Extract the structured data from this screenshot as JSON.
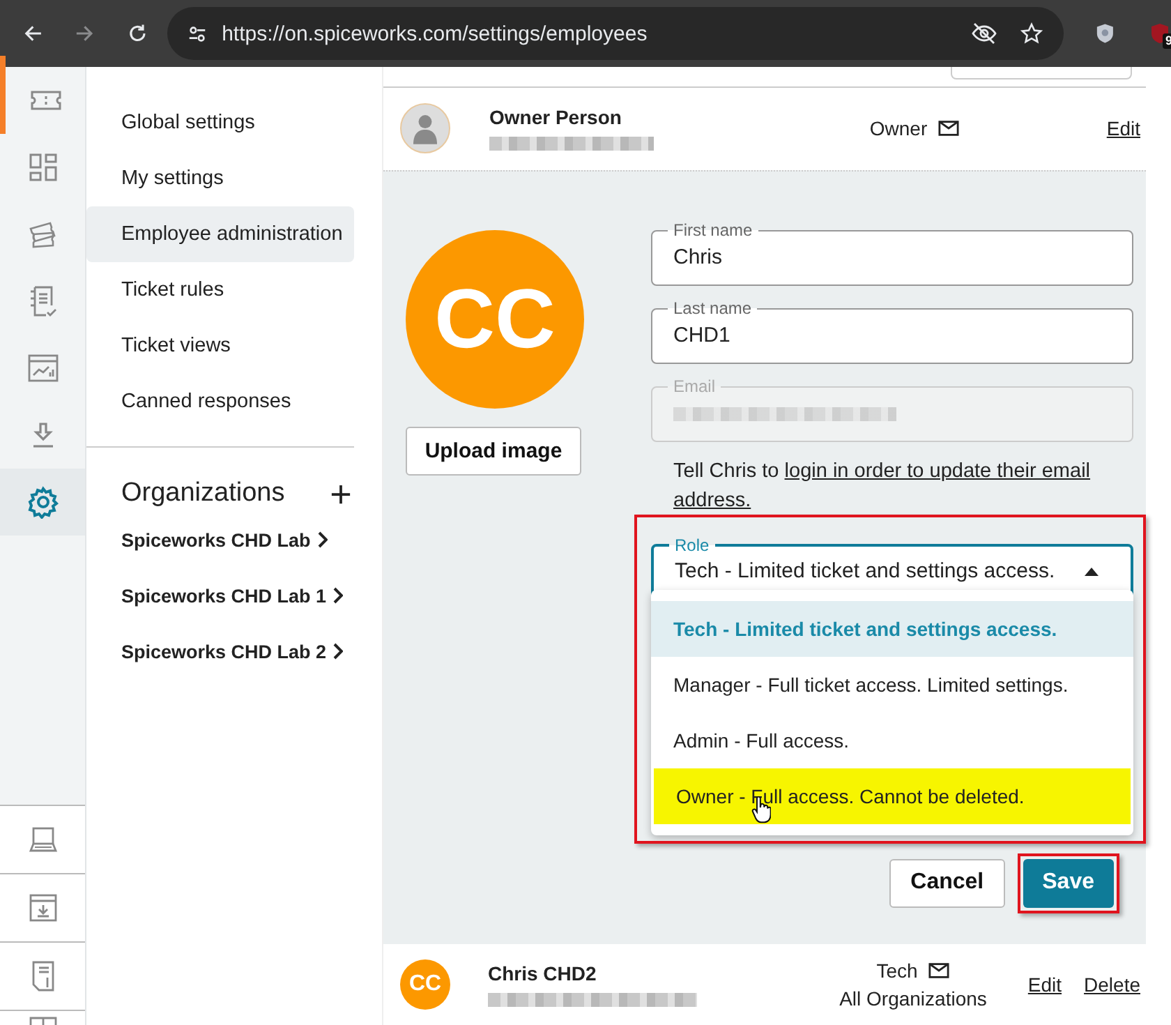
{
  "browser": {
    "url": "https://on.spiceworks.com/settings/employees",
    "extension_badge": "9"
  },
  "app_rail": {
    "top": [
      {
        "kind": "ticket",
        "selected": false
      },
      {
        "kind": "dashboard",
        "selected": false
      },
      {
        "kind": "tickets",
        "selected": false
      },
      {
        "kind": "checklist",
        "selected": false
      },
      {
        "kind": "reports",
        "selected": false
      },
      {
        "kind": "download",
        "selected": false
      },
      {
        "kind": "settings",
        "selected": true
      }
    ],
    "bottom": [
      {
        "kind": "laptop"
      },
      {
        "kind": "inbox"
      },
      {
        "kind": "invoice"
      },
      {
        "kind": "layout"
      }
    ]
  },
  "settings_nav": [
    {
      "label": "Global settings",
      "selected": false
    },
    {
      "label": "My settings",
      "selected": false
    },
    {
      "label": "Employee administration",
      "selected": true
    },
    {
      "label": "Ticket rules",
      "selected": false
    },
    {
      "label": "Ticket views",
      "selected": false
    },
    {
      "label": "Canned responses",
      "selected": false
    }
  ],
  "organizations": {
    "title": "Organizations",
    "items": [
      "Spiceworks CHD Lab",
      "Spiceworks CHD Lab 1",
      "Spiceworks CHD Lab 2"
    ]
  },
  "owner_row": {
    "name": "Owner Person",
    "role": "Owner",
    "actions": [
      "Edit"
    ]
  },
  "edit_form": {
    "initials": "CC",
    "upload_label": "Upload image",
    "fields": [
      {
        "label": "First name",
        "value": "Chris",
        "disabled": false
      },
      {
        "label": "Last name",
        "value": "CHD1",
        "disabled": false
      },
      {
        "label": "Email",
        "disabled": true
      }
    ],
    "help_text": "Tell Chris to ",
    "help_link_lines": [
      "login in order to update their email",
      "address."
    ],
    "role": {
      "label": "Role",
      "value": "Tech - Limited ticket and settings access.",
      "highlighted": true,
      "options": [
        {
          "label": "Tech - Limited ticket and settings access.",
          "selected": true,
          "highlighted": false
        },
        {
          "label": "Manager - Full ticket access. Limited settings.",
          "selected": false,
          "highlighted": false
        },
        {
          "label": "Admin - Full access.",
          "selected": false,
          "highlighted": false
        },
        {
          "label": "Owner - Full access. Cannot be deleted.",
          "selected": false,
          "highlighted": true
        }
      ]
    },
    "buttons": [
      {
        "label": "Cancel",
        "kind": "secondary",
        "highlighted": false
      },
      {
        "label": "Save",
        "kind": "primary",
        "highlighted": true
      }
    ]
  },
  "employee_row": {
    "initials": "CC",
    "name": "Chris CHD2",
    "role": "Tech",
    "organizations": "All Organizations",
    "actions": [
      "Edit",
      "Delete"
    ]
  }
}
